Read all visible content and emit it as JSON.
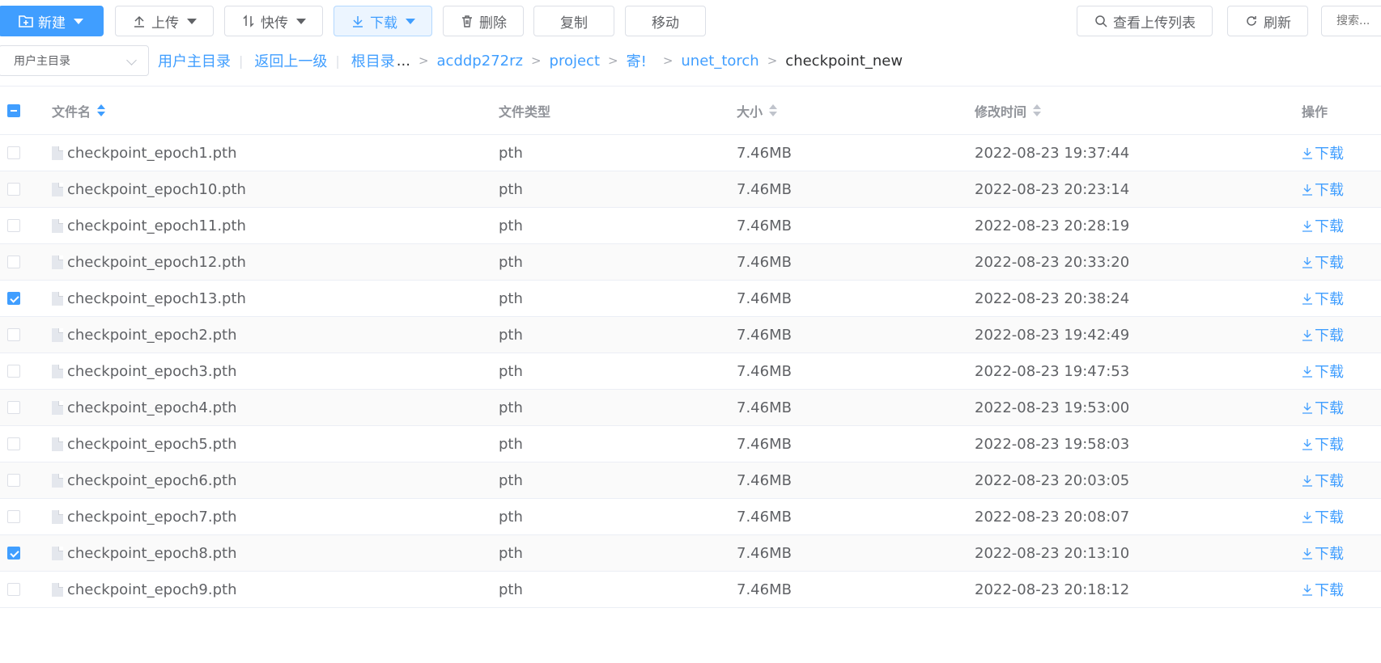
{
  "toolbar": {
    "new_label": "新建",
    "upload_label": "上传",
    "fast_upload_label": "快传",
    "download_label": "下载",
    "delete_label": "删除",
    "copy_label": "复制",
    "move_label": "移动",
    "view_upload_list_label": "查看上传列表",
    "refresh_label": "刷新",
    "search_placeholder": "搜索..."
  },
  "breadcrumb": {
    "dir_select_value": "用户主目录",
    "home_link": "用户主目录",
    "up_link": "返回上一级",
    "root_link": "根目录",
    "ellipsis": "...",
    "path": [
      "acddp272rz",
      "project",
      "寄!",
      "unet_torch"
    ],
    "current": "checkpoint_new"
  },
  "table": {
    "headers": {
      "name": "文件名",
      "type": "文件类型",
      "size": "大小",
      "modified": "修改时间",
      "actions": "操作"
    },
    "download_action": "下载",
    "rows": [
      {
        "name": "checkpoint_epoch1.pth",
        "type": "pth",
        "size": "7.46MB",
        "modified": "2022-08-23 19:37:44",
        "checked": false
      },
      {
        "name": "checkpoint_epoch10.pth",
        "type": "pth",
        "size": "7.46MB",
        "modified": "2022-08-23 20:23:14",
        "checked": false
      },
      {
        "name": "checkpoint_epoch11.pth",
        "type": "pth",
        "size": "7.46MB",
        "modified": "2022-08-23 20:28:19",
        "checked": false
      },
      {
        "name": "checkpoint_epoch12.pth",
        "type": "pth",
        "size": "7.46MB",
        "modified": "2022-08-23 20:33:20",
        "checked": false
      },
      {
        "name": "checkpoint_epoch13.pth",
        "type": "pth",
        "size": "7.46MB",
        "modified": "2022-08-23 20:38:24",
        "checked": true
      },
      {
        "name": "checkpoint_epoch2.pth",
        "type": "pth",
        "size": "7.46MB",
        "modified": "2022-08-23 19:42:49",
        "checked": false
      },
      {
        "name": "checkpoint_epoch3.pth",
        "type": "pth",
        "size": "7.46MB",
        "modified": "2022-08-23 19:47:53",
        "checked": false
      },
      {
        "name": "checkpoint_epoch4.pth",
        "type": "pth",
        "size": "7.46MB",
        "modified": "2022-08-23 19:53:00",
        "checked": false
      },
      {
        "name": "checkpoint_epoch5.pth",
        "type": "pth",
        "size": "7.46MB",
        "modified": "2022-08-23 19:58:03",
        "checked": false
      },
      {
        "name": "checkpoint_epoch6.pth",
        "type": "pth",
        "size": "7.46MB",
        "modified": "2022-08-23 20:03:05",
        "checked": false
      },
      {
        "name": "checkpoint_epoch7.pth",
        "type": "pth",
        "size": "7.46MB",
        "modified": "2022-08-23 20:08:07",
        "checked": false
      },
      {
        "name": "checkpoint_epoch8.pth",
        "type": "pth",
        "size": "7.46MB",
        "modified": "2022-08-23 20:13:10",
        "checked": true
      },
      {
        "name": "checkpoint_epoch9.pth",
        "type": "pth",
        "size": "7.46MB",
        "modified": "2022-08-23 20:18:12",
        "checked": false
      }
    ]
  },
  "colors": {
    "primary": "#409eff",
    "border": "#dcdfe6",
    "text": "#606266",
    "header_text": "#909399"
  },
  "icons": {
    "new": "folder-plus-icon",
    "upload": "upload-icon",
    "fast_upload": "transfer-icon",
    "download": "download-icon",
    "delete": "trash-icon",
    "view_upload_list": "search-icon",
    "refresh": "refresh-icon",
    "file": "file-icon"
  }
}
